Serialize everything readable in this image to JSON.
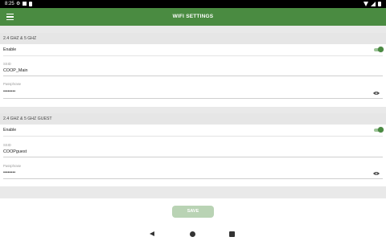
{
  "status_bar": {
    "time": "8:25",
    "icons": [
      "gear-icon",
      "sim-card-icon",
      "battery-icon",
      "wifi-icon",
      "signal-icon",
      "battery-full-icon"
    ]
  },
  "app_bar": {
    "title": "WIFI SETTINGS",
    "menu_icon": "menu-icon",
    "color": "#4a8b41"
  },
  "sections": [
    {
      "header": "2.4 GHZ & 5 GHZ",
      "enable_label": "Enable",
      "enabled": true,
      "ssid_label": "SSID",
      "ssid_value": "COOP_Main",
      "passphrase_label": "Passphrase",
      "passphrase_value": "••••••••"
    },
    {
      "header": "2.4 GHZ & 5 GHZ GUEST",
      "enable_label": "Enable",
      "enabled": true,
      "ssid_label": "SSID",
      "ssid_value": "COOPguest",
      "passphrase_label": "Passphrase",
      "passphrase_value": "••••••••"
    }
  ],
  "footer": {
    "save_label": "SAVE"
  },
  "nav_bar": {
    "icons": [
      "back-icon",
      "home-icon",
      "recent-apps-icon"
    ]
  }
}
